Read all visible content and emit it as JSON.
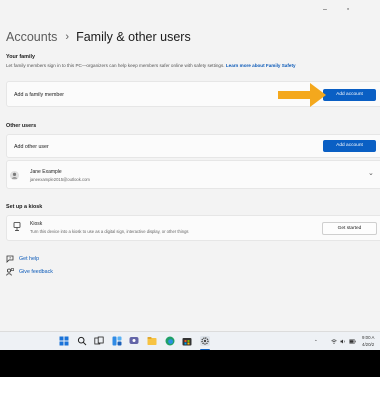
{
  "breadcrumb": {
    "parent": "Accounts",
    "separator": "›",
    "current": "Family & other users"
  },
  "your_family": {
    "heading": "Your family",
    "description": "Let family members sign in to this PC—organizers can help keep members safer online with safety settings.",
    "link": "Learn more about Family Safety",
    "row_label": "Add a family member",
    "button": "Add account"
  },
  "other_users": {
    "heading": "Other users",
    "row_label": "Add other user",
    "button": "Add account",
    "user": {
      "name": "Jane Example",
      "email": "janeexample2015@outlook.com"
    }
  },
  "kiosk": {
    "heading": "Set up a kiosk",
    "title": "Kiosk",
    "description": "Turn this device into a kiosk to use as a digital sign, interactive display, or other things",
    "button": "Get started"
  },
  "help": {
    "get_help": "Get help",
    "give_feedback": "Give feedback"
  },
  "taskbar": {
    "icons": [
      "windows-start-icon",
      "search-icon",
      "task-view-icon",
      "widgets-icon",
      "teams-chat-icon",
      "file-explorer-icon",
      "edge-browser-icon",
      "microsoft-store-icon",
      "mail-icon",
      "settings-icon"
    ],
    "time": "9:00 A",
    "date": "4/20/2"
  },
  "colors": {
    "accent": "#0a5fc4",
    "arrow": "#f4a81d",
    "link": "#0a59b8"
  }
}
